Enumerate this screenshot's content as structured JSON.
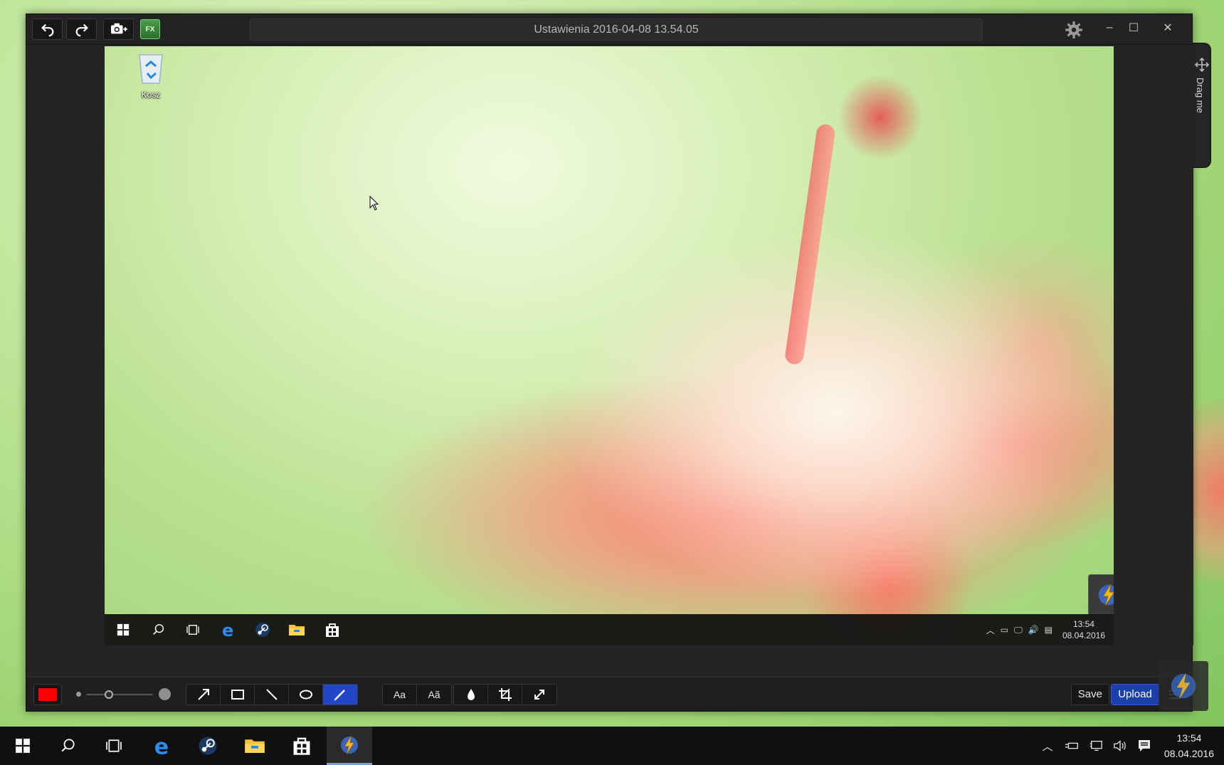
{
  "window": {
    "title": "Ustawienia 2016-04-08 13.54.05"
  },
  "titlebar": {
    "undo_icon": "undo-icon",
    "redo_icon": "redo-icon",
    "camera_icon": "camera-plus-icon",
    "fx_label": "FX",
    "settings_icon": "gear-icon",
    "minimize": "–",
    "maximize": "☐",
    "close": "✕"
  },
  "canvas": {
    "desktop_icon_label": "Kosz",
    "inner_taskbar": {
      "time": "13:54",
      "date": "08.04.2016"
    }
  },
  "drag_tab": {
    "label": "Drag me"
  },
  "toolbar": {
    "color": "#ff0000",
    "tools": [
      "arrow",
      "rectangle",
      "line",
      "ellipse",
      "pen",
      "text",
      "text-outline",
      "blur",
      "crop",
      "resize"
    ],
    "active_tool": "pen",
    "text_label": "Aa",
    "text_outline_label": "Aã",
    "save_label": "Save",
    "upload_label": "Upload"
  },
  "taskbar": {
    "time": "13:54",
    "date": "08.04.2016"
  },
  "colors": {
    "active_tool": "#2246c6",
    "upload": "#1d3fae",
    "window_bg": "#242424"
  }
}
